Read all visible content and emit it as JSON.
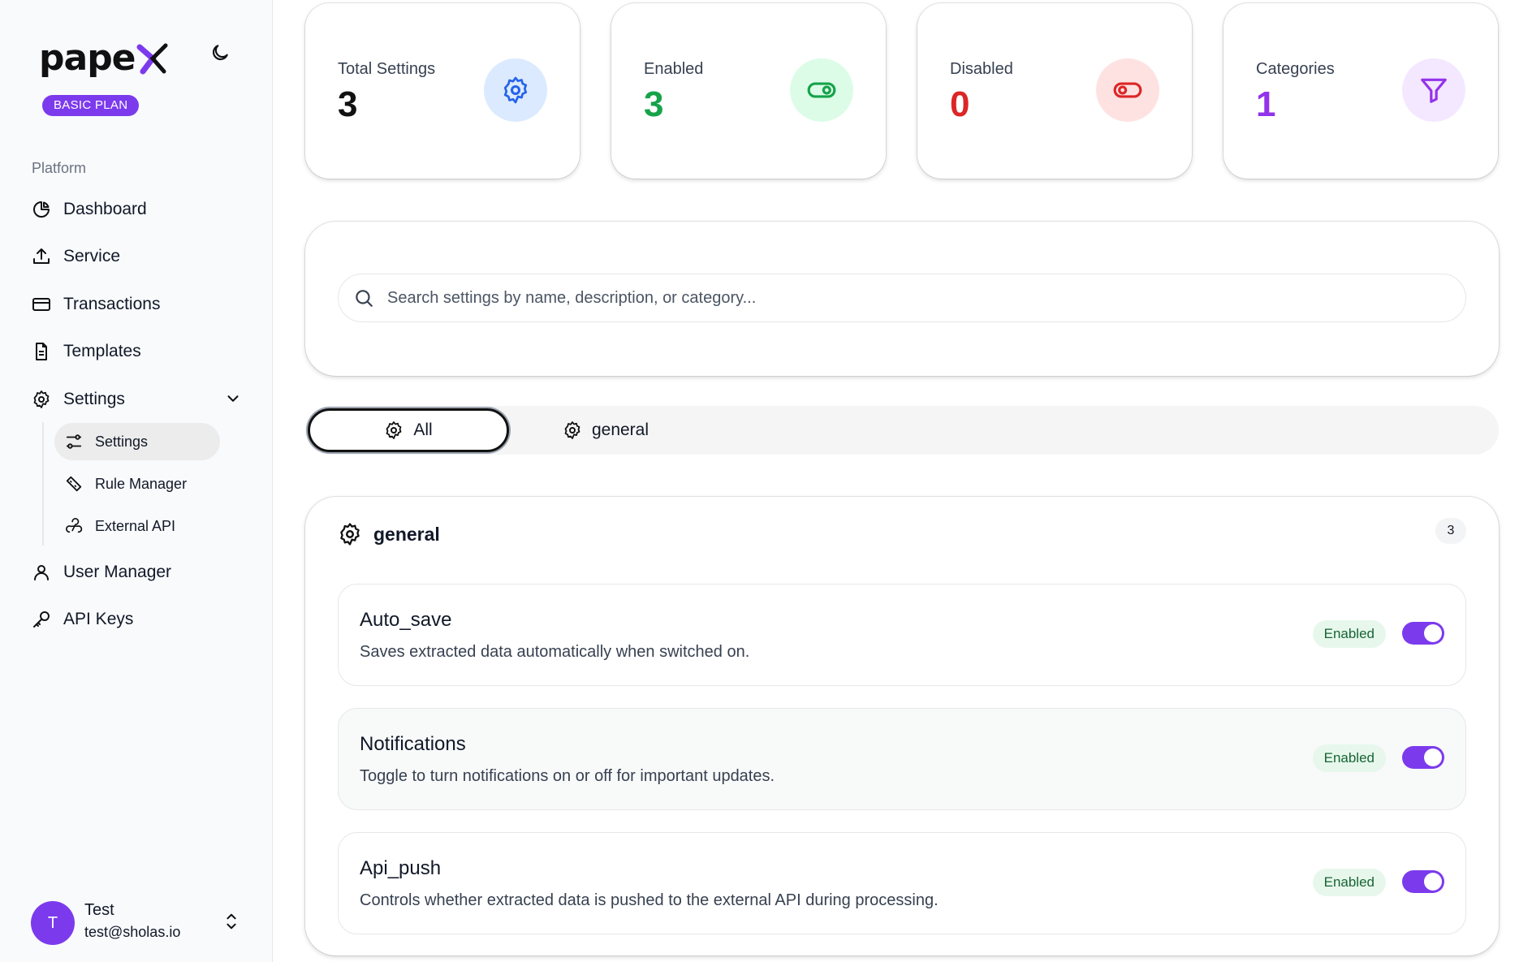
{
  "brand": {
    "name": "pape",
    "plan": "BASIC PLAN"
  },
  "sidebar": {
    "section": "Platform",
    "items": [
      {
        "label": "Dashboard",
        "icon": "pie-chart-icon"
      },
      {
        "label": "Service",
        "icon": "upload-icon"
      },
      {
        "label": "Transactions",
        "icon": "credit-card-icon"
      },
      {
        "label": "Templates",
        "icon": "document-icon"
      },
      {
        "label": "Settings",
        "icon": "gear-icon"
      },
      {
        "label": "User Manager",
        "icon": "user-icon"
      },
      {
        "label": "API Keys",
        "icon": "key-icon"
      }
    ],
    "subitems": [
      {
        "label": "Settings",
        "icon": "sliders-icon",
        "active": true
      },
      {
        "label": "Rule Manager",
        "icon": "ruler-icon"
      },
      {
        "label": "External API",
        "icon": "webhook-icon"
      }
    ]
  },
  "user": {
    "initial": "T",
    "name": "Test",
    "email": "test@sholas.io"
  },
  "stats": [
    {
      "label": "Total Settings",
      "value": "3",
      "color": "#111111",
      "bg": "#dbeafe",
      "icon": "gear-icon",
      "icon_color": "#2563eb"
    },
    {
      "label": "Enabled",
      "value": "3",
      "color": "#16a34a",
      "bg": "#dcfce7",
      "icon": "toggle-on-icon",
      "icon_color": "#16a34a"
    },
    {
      "label": "Disabled",
      "value": "0",
      "color": "#dc2626",
      "bg": "#fee2e2",
      "icon": "toggle-off-icon",
      "icon_color": "#dc2626"
    },
    {
      "label": "Categories",
      "value": "1",
      "color": "#9333ea",
      "bg": "#f3e8ff",
      "icon": "filter-icon",
      "icon_color": "#9333ea"
    }
  ],
  "search": {
    "placeholder": "Search settings by name, description, or category..."
  },
  "tabs": [
    {
      "label": "All",
      "active": true
    },
    {
      "label": "general",
      "active": false
    }
  ],
  "group": {
    "title": "general",
    "count": "3",
    "settings": [
      {
        "name": "Auto_save",
        "description": "Saves extracted data automatically when switched on.",
        "status": "Enabled"
      },
      {
        "name": "Notifications",
        "description": "Toggle to turn notifications on or off for important updates.",
        "status": "Enabled"
      },
      {
        "name": "Api_push",
        "description": "Controls whether extracted data is pushed to the external API during processing.",
        "status": "Enabled"
      }
    ]
  },
  "colors": {
    "accent": "#7c3aed",
    "enabled_bg": "#e7f7ec",
    "enabled_text": "#166534"
  }
}
